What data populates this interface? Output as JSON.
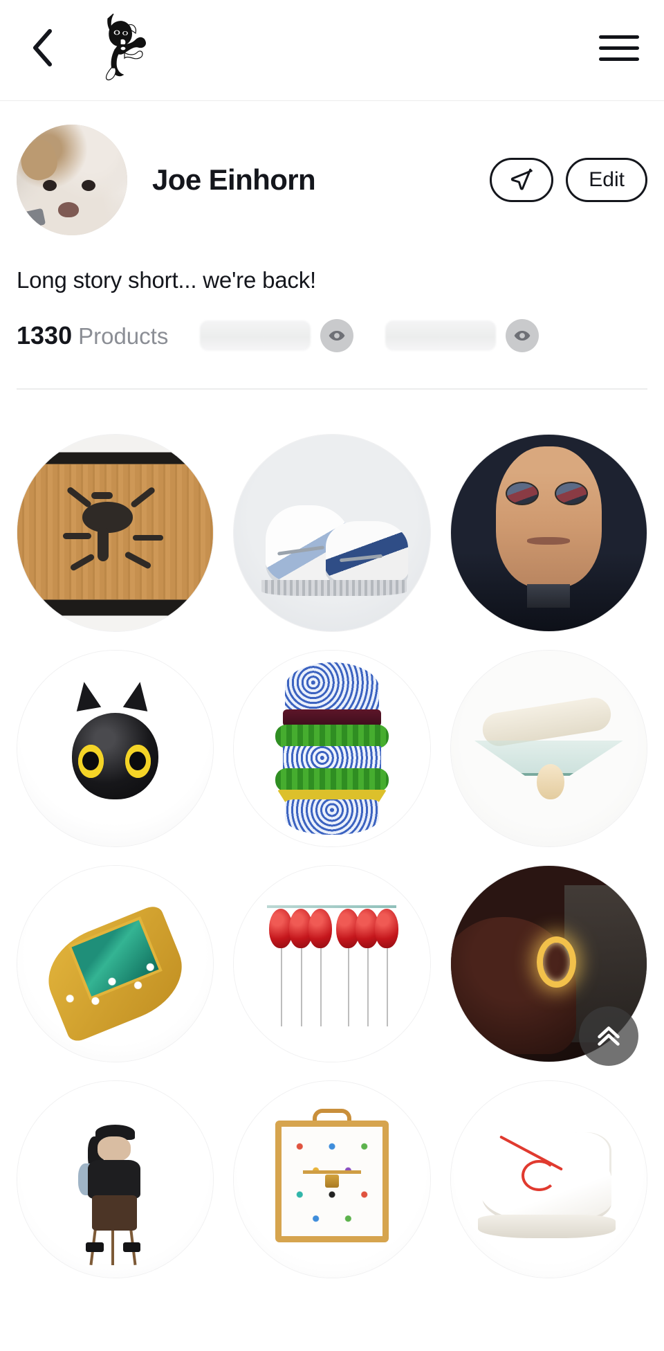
{
  "header": {
    "back_icon": "chevron-left-icon",
    "logo_icon": "fancy-dog-logo",
    "logo_label": "Fancy",
    "menu_icon": "hamburger-menu-icon"
  },
  "profile": {
    "avatar_icon": "user-avatar-dog-photo",
    "name": "Joe Einhorn",
    "share_icon": "send-paper-plane-icon",
    "share_label": "Share",
    "edit_label": "Edit",
    "bio": "Long story short... we're back!"
  },
  "stats": {
    "products_count": "1330",
    "products_label": "Products",
    "hidden": [
      {
        "eye_icon": "eye-icon",
        "value": ""
      },
      {
        "eye_icon": "eye-icon",
        "value": ""
      }
    ]
  },
  "grid": {
    "items": [
      {
        "name": "keith-haring-plywood-graffiti",
        "art": "art-haring"
      },
      {
        "name": "air-jordan-3-true-blue-sneakers",
        "art": "art-jordan"
      },
      {
        "name": "hyperrealistic-face-sculpture",
        "art": "art-face"
      },
      {
        "name": "black-cat-head-yellow-eyes-sculpture",
        "art": "art-cat"
      },
      {
        "name": "blue-white-porcelain-burger-sculpture",
        "art": "art-burger"
      },
      {
        "name": "glass-table-with-egg",
        "art": "art-glasstable"
      },
      {
        "name": "emerald-diamond-gold-ring",
        "art": "art-emerald"
      },
      {
        "name": "red-balloon-table",
        "art": "art-balloons"
      },
      {
        "name": "glowing-gold-ring-in-hand",
        "art": "art-goldring"
      },
      {
        "name": "seated-figure-art-toy",
        "art": "art-figure"
      },
      {
        "name": "louis-vuitton-multicolore-vanity-case",
        "art": "art-lv"
      },
      {
        "name": "off-white-nike-white-sneaker",
        "art": "art-sneaker"
      }
    ]
  },
  "fab": {
    "icon": "double-chevron-up-icon",
    "label": "Scroll to top"
  },
  "colors": {
    "text": "#14161c",
    "muted": "#8b8e95",
    "divider": "#eceded",
    "skeleton": "#eceded",
    "eye_badge": "#c9cacc",
    "fab_bg": "rgba(60,60,60,0.72)"
  }
}
